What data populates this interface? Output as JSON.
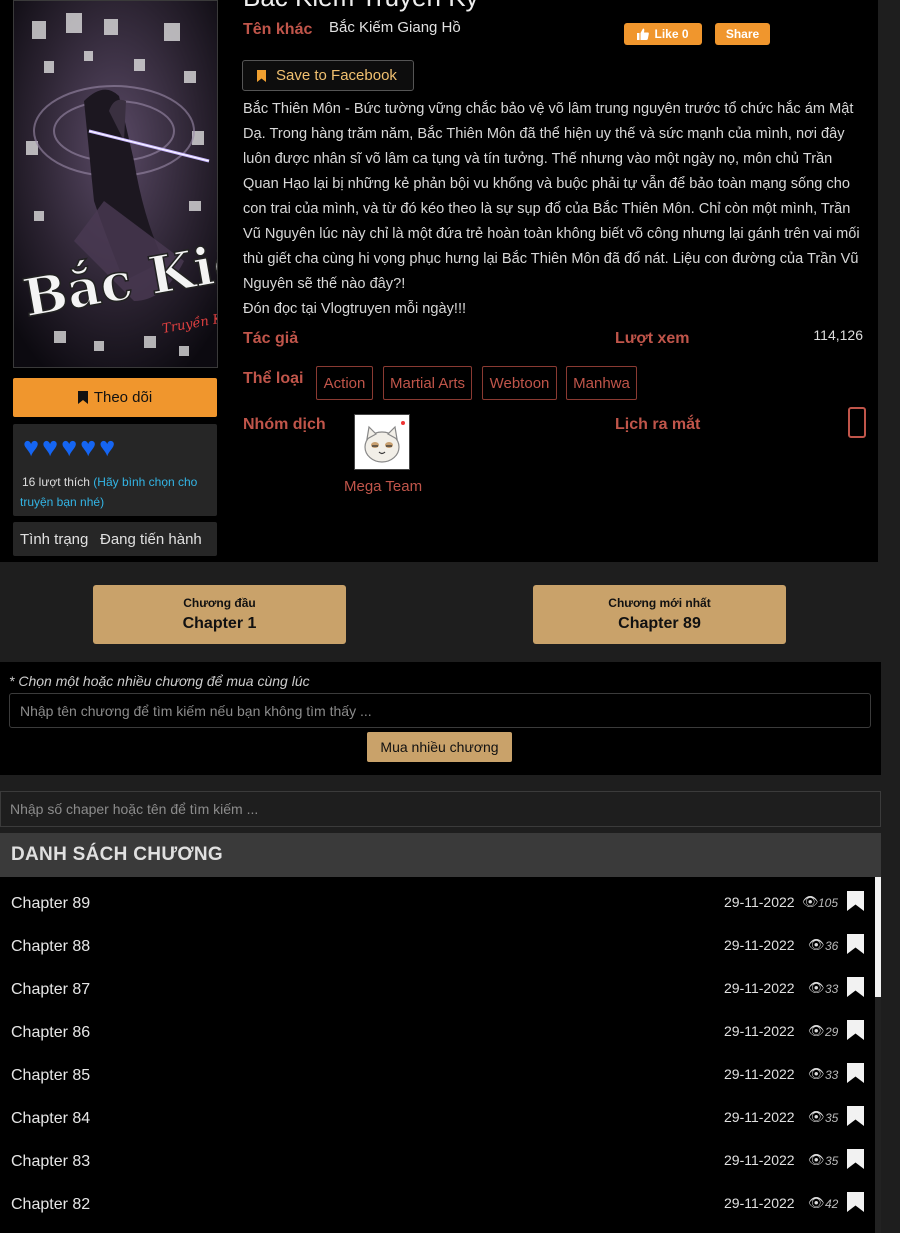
{
  "comic": {
    "title": "Bắc Kiếm Truyền Kỳ",
    "alt_label": "Tên khác",
    "alt_name": "Bắc Kiếm Giang Hồ",
    "cover_logo": "Bắc Kiếm",
    "cover_sub": "Truyền Kỳ"
  },
  "social": {
    "like_label": "Like 0",
    "share_label": "Share",
    "save_label": "Save to Facebook"
  },
  "description": {
    "text": "Bắc Thiên Môn - Bức tường vững chắc bảo vệ võ lâm trung nguyên trước tổ chức hắc ám Mật Dạ. Trong hàng trăm năm, Bắc Thiên Môn đã thể hiện uy thế và sức mạnh của mình, nơi đây luôn được nhân sĩ võ lâm ca tụng và tín tưởng. Thế nhưng vào một ngày nọ, môn chủ Trần Quan Hạo lại bị những kẻ phản bội vu khống và buộc phải tự vẫn để bảo toàn mạng sống cho con trai của mình, và từ đó kéo theo là sự sụp đổ của Bắc Thiên Môn. Chỉ còn một mình, Trần Vũ Nguyên lúc này chỉ là một đứa trẻ hoàn toàn không biết võ công nhưng lại gánh trên vai mối thù giết cha cùng hi vọng phục hưng lại Bắc Thiên Môn đã đổ nát. Liệu con đường của Trần Vũ Nguyên sẽ thế nào đây?!",
    "footer": "Đón đọc tại Vlogtruyen mỗi ngày!!!"
  },
  "meta": {
    "author_label": "Tác giả",
    "views_label": "Lượt xem",
    "views_value": "114,126",
    "genre_label": "Thể loại",
    "genres": [
      "Action",
      "Martial Arts",
      "Webtoon",
      "Manhwa"
    ],
    "team_label": "Nhóm dịch",
    "team_name": "Mega Team",
    "release_label": "Lịch ra mắt"
  },
  "sidebar": {
    "follow_label": "Theo dõi",
    "likes_count": "16 lượt thích",
    "likes_hint": "(Hãy bình chọn cho truyện bạn nhé)",
    "status_label": "Tình trạng",
    "status_value": "Đang tiến hành",
    "rating_hearts": 5
  },
  "nav": {
    "first_label": "Chương đầu",
    "first_chapter": "Chapter 1",
    "latest_label": "Chương mới nhất",
    "latest_chapter": "Chapter 89"
  },
  "buy": {
    "note": "* Chọn một hoặc nhiều chương để mua cùng lúc",
    "placeholder": "Nhập tên chương để tìm kiếm nếu bạn không tìm thấy ...",
    "button_label": "Mua nhiều chương"
  },
  "search": {
    "placeholder": "Nhập số chaper hoặc tên để tìm kiếm ..."
  },
  "list": {
    "header": "DANH SÁCH CHƯƠNG",
    "chapters": [
      {
        "name": "Chapter 89",
        "date": "29-11-2022",
        "views": "105"
      },
      {
        "name": "Chapter 88",
        "date": "29-11-2022",
        "views": "36"
      },
      {
        "name": "Chapter 87",
        "date": "29-11-2022",
        "views": "33"
      },
      {
        "name": "Chapter 86",
        "date": "29-11-2022",
        "views": "29"
      },
      {
        "name": "Chapter 85",
        "date": "29-11-2022",
        "views": "33"
      },
      {
        "name": "Chapter 84",
        "date": "29-11-2022",
        "views": "35"
      },
      {
        "name": "Chapter 83",
        "date": "29-11-2022",
        "views": "35"
      },
      {
        "name": "Chapter 82",
        "date": "29-11-2022",
        "views": "42"
      }
    ]
  },
  "colors": {
    "accent_orange": "#f0962d",
    "gold_button": "#c9a26a",
    "label_red": "#c0554a",
    "heart_blue": "#1565f2",
    "hint_cyan": "#33b5e5"
  },
  "icons": {
    "follow": "bookmark-icon",
    "save": "bookmark-icon",
    "like": "thumbs-up-icon",
    "views": "eye-icon",
    "chapter_bookmark": "bookmark-icon",
    "rating": "heart-icon"
  }
}
